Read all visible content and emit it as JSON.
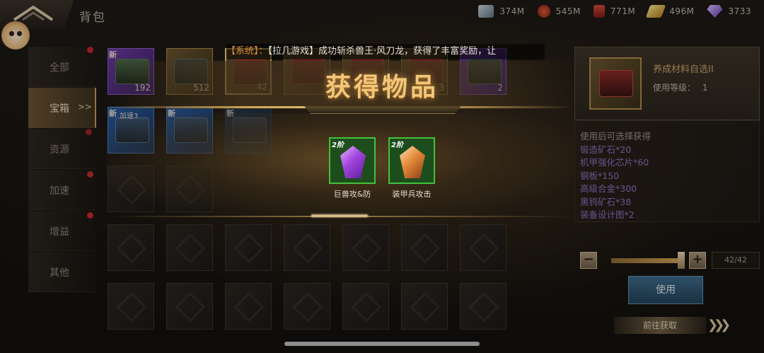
{
  "header": {
    "title": "背包"
  },
  "resources": [
    {
      "icon": "steel-plate-icon",
      "value": "374M",
      "color": "#8aa0b0"
    },
    {
      "icon": "fuel-barrel-icon",
      "value": "545M",
      "color": "#c03a2a"
    },
    {
      "icon": "oil-drum-icon",
      "value": "771M",
      "color": "#b8322c"
    },
    {
      "icon": "gold-bar-icon",
      "value": "496M",
      "color": "#e0b23c"
    },
    {
      "icon": "diamond-icon",
      "value": "3733",
      "color": "#a27be0"
    }
  ],
  "sidebar": {
    "items": [
      {
        "label": "全部",
        "badge": true,
        "active": false
      },
      {
        "label": "宝箱",
        "badge": true,
        "active": true
      },
      {
        "label": "资源",
        "badge": true,
        "active": false
      },
      {
        "label": "加速",
        "badge": true,
        "active": false
      },
      {
        "label": "增益",
        "badge": false,
        "active": false
      },
      {
        "label": "其他",
        "badge": true,
        "active": false
      }
    ]
  },
  "grid": {
    "items": [
      {
        "new_tag": "新",
        "count": "192",
        "rarity": "purple"
      },
      {
        "new_tag": "",
        "count": "512",
        "rarity": "gold"
      },
      {
        "new_tag": "",
        "count": "42",
        "rarity": "gold",
        "selected": true
      },
      {
        "new_tag": "",
        "count": "",
        "rarity": "gold"
      },
      {
        "new_tag": "",
        "count": "",
        "rarity": "gold"
      },
      {
        "new_tag": "",
        "count": "3",
        "rarity": "gold"
      },
      {
        "new_tag": "",
        "count": "2",
        "rarity": "purple"
      },
      {
        "new_tag": "新",
        "sub_label": "加速3",
        "count": "",
        "rarity": "blue"
      },
      {
        "new_tag": "新",
        "sub_label": "",
        "count": "",
        "rarity": "blue"
      },
      {
        "new_tag": "新",
        "sub_label": "",
        "count": "",
        "rarity": "dimblue"
      }
    ]
  },
  "detail": {
    "name": "养成材料自选II",
    "level_label": "使用等级：",
    "level_value": "1",
    "desc_lead": "使用后可选择获得",
    "lines": [
      "锻造矿石*20",
      "机甲强化芯片*60",
      "钢板*150",
      "高级合金*300",
      "黑钨矿石*38",
      "装备设计图*2"
    ],
    "quantity": "42/42",
    "quantity_fraction": 1.0,
    "use_label": "使用",
    "goto_label": "前往获取"
  },
  "system_message": {
    "tag": "【系统】",
    "separator": "：",
    "text": "【拉几游戏】成功斩杀兽王·风刀龙，获得了丰富奖励，让"
  },
  "reward_popup": {
    "title": "获得物品",
    "rewards": [
      {
        "tier": "2阶",
        "label": "巨兽攻&防",
        "icon": "purple-crystal-icon"
      },
      {
        "tier": "2阶",
        "label": "装甲兵攻击",
        "icon": "orange-crystal-icon"
      }
    ]
  }
}
